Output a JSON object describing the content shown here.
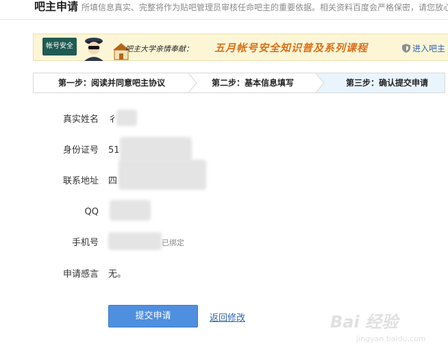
{
  "header": {
    "title": "吧主申请",
    "description": "所填信息真实、完整将作为贴吧管理员审核任命吧主的重要依据。相关资料百度会严格保密，请您放心"
  },
  "banner": {
    "badge": "帐号安全",
    "lead": "吧主大学亲情奉献：",
    "main": "五月帐号安全知识普及系列课程",
    "link": "进入吧主"
  },
  "steps": [
    {
      "label": "第一步：阅读并同意吧主协议"
    },
    {
      "label": "第二步：基本信息填写"
    },
    {
      "label": "第三步：确认提交申请"
    }
  ],
  "form": {
    "name": {
      "label": "真实姓名",
      "value": "彳"
    },
    "id": {
      "label": "身份证号",
      "value": "51"
    },
    "address": {
      "label": "联系地址",
      "value": "四"
    },
    "qq": {
      "label": "QQ",
      "value": ""
    },
    "phone": {
      "label": "手机号",
      "value": "",
      "status": "已绑定"
    },
    "statement": {
      "label": "申请感言",
      "value": "无。"
    }
  },
  "actions": {
    "submit": "提交申请",
    "back": "返回修改"
  },
  "watermark": {
    "text": "Bai 经验",
    "url": "jingyan.baidu.com"
  }
}
